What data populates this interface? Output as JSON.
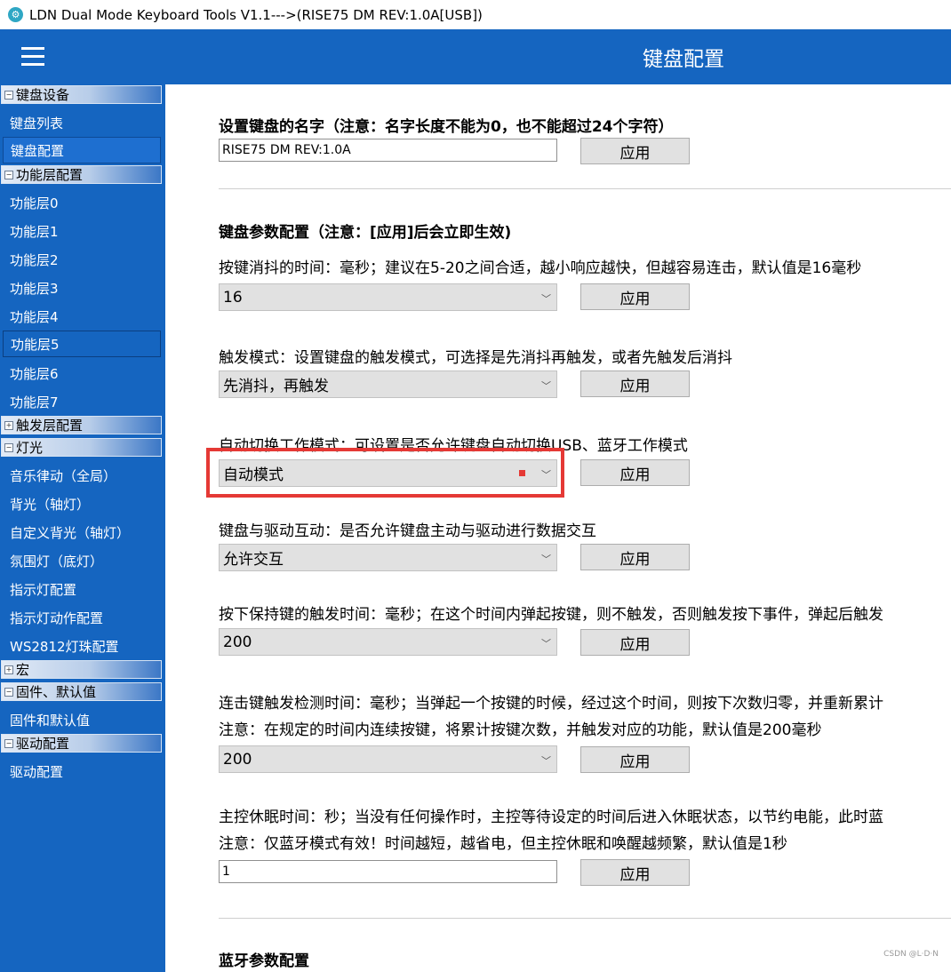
{
  "window": {
    "title": "LDN Dual Mode Keyboard Tools V1.1--->(RISE75 DM REV:1.0A[USB])"
  },
  "header": {
    "title": "键盘配置"
  },
  "sidebar": {
    "groups": {
      "keyboard_device": "键盘设备",
      "layer_config": "功能层配置",
      "trigger_layer": "触发层配置",
      "light": "灯光",
      "macro": "宏",
      "firmware": "固件、默认值",
      "driver": "驱动配置"
    },
    "items": {
      "keyboard_list": "键盘列表",
      "keyboard_config": "键盘配置",
      "layer0": "功能层0",
      "layer1": "功能层1",
      "layer2": "功能层2",
      "layer3": "功能层3",
      "layer4": "功能层4",
      "layer5": "功能层5",
      "layer6": "功能层6",
      "layer7": "功能层7",
      "music_rhythm": "音乐律动（全局）",
      "backlight": "背光（轴灯）",
      "custom_backlight": "自定义背光（轴灯）",
      "ambient_light": "氛围灯（底灯）",
      "indicator_config": "指示灯配置",
      "indicator_action": "指示灯动作配置",
      "ws2812": "WS2812灯珠配置",
      "firmware_defaults": "固件和默认值",
      "driver_config": "驱动配置"
    }
  },
  "main": {
    "apply_label": "应用",
    "name_section": {
      "title": "设置键盘的名字（注意：名字长度不能为0，也不能超过24个字符）",
      "value": "RISE75 DM REV:1.0A"
    },
    "params_title": "键盘参数配置（注意：[应用]后会立即生效)",
    "debounce": {
      "desc": "按键消抖的时间：毫秒；建议在5-20之间合适，越小响应越快，但越容易连击，默认值是16毫秒",
      "value": "16"
    },
    "trigger_mode": {
      "desc": "触发模式：设置键盘的触发模式，可选择是先消抖再触发，或者先触发后消抖",
      "value": "先消抖，再触发"
    },
    "auto_switch": {
      "desc": "自动切换工作模式：可设置是否允许键盘自动切换USB、蓝牙工作模式",
      "value": "自动模式"
    },
    "driver_interact": {
      "desc": "键盘与驱动互动：是否允许键盘主动与驱动进行数据交互",
      "value": "允许交互"
    },
    "hold_trigger": {
      "desc": "按下保持键的触发时间：毫秒；在这个时间内弹起按键，则不触发，否则触发按下事件，弹起后触发",
      "value": "200"
    },
    "tap_detect": {
      "desc1": "连击键触发检测时间：毫秒；当弹起一个按键的时候，经过这个时间，则按下次数归零，并重新累计",
      "desc2": "注意：在规定的时间内连续按键，将累计按键次数，并触发对应的功能，默认值是200毫秒",
      "value": "200"
    },
    "sleep": {
      "desc1": "主控休眠时间：秒；当没有任何操作时，主控等待设定的时间后进入休眠状态，以节约电能，此时蓝",
      "desc2": "注意：仅蓝牙模式有效！时间越短，越省电，但主控休眠和唤醒越频繁，默认值是1秒",
      "value": "1"
    },
    "bluetooth_title": "蓝牙参数配置"
  },
  "watermark": "CSDN @L·D·N",
  "colors": {
    "header_blue": "#1565c0",
    "highlight_red": "#e53935"
  }
}
